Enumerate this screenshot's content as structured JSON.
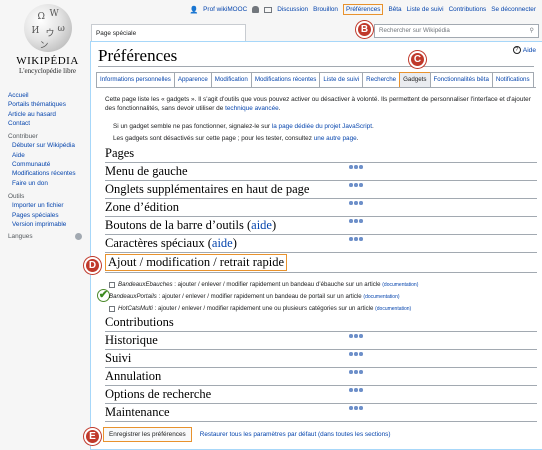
{
  "logo": {
    "wordmark": "WIKIPÉDIA",
    "tagline": "L'encyclopédie libre"
  },
  "personal": {
    "user": "Prof wikiMOOC",
    "links": [
      "Discussion",
      "Brouillon"
    ],
    "preferences": "Préférences",
    "more_links": [
      "Bêta",
      "Liste de suivi",
      "Contributions",
      "Se déconnecter"
    ]
  },
  "sidebar": {
    "nav": [
      "Accueil",
      "Portails thématiques",
      "Article au hasard",
      "Contact"
    ],
    "contribute_heading": "Contribuer",
    "contribute": [
      "Débuter sur Wikipédia",
      "Aide",
      "Communauté",
      "Modifications récentes",
      "Faire un don"
    ],
    "tools_heading": "Outils",
    "tools": [
      "Importer un fichier",
      "Pages spéciales",
      "Version imprimable"
    ],
    "languages_heading": "Langues"
  },
  "page_tab": "Page spéciale",
  "search": {
    "placeholder": "Rechercher sur Wikipédia"
  },
  "page": {
    "title": "Préférences",
    "help": "Aide",
    "tabs": [
      "Informations personnelles",
      "Apparence",
      "Modification",
      "Modifications récentes",
      "Liste de suivi",
      "Recherche",
      "Gadgets",
      "Fonctionnalités bêta",
      "Notifications"
    ],
    "intro_1": "Cette page liste les « gadgets ». Il s'agit d'outils que vous pouvez activer ou désactiver à volonté. Ils permettent de personnaliser l'interface et d'ajouter des fonctionnalités, sans devoir utiliser de ",
    "intro_link": "technique avancée",
    "intro_end": ".",
    "note_1": "Si un gadget semble ne pas fonctionner, signalez-le sur ",
    "note_1_link": "la page dédiée du projet JavaScript",
    "note_1_end": ".",
    "note_2": "Les gadgets sont désactivés sur cette page ; pour les tester, consultez ",
    "note_2_link": "une autre page",
    "note_2_end": ".",
    "sections": {
      "pages": "Pages",
      "menu": "Menu de gauche",
      "onglets": "Onglets supplémentaires en haut de page",
      "zone": "Zone d’édition",
      "boutons": "Boutons de la barre d’outils (",
      "boutons_link": "aide",
      "caracteres": "Caractères spéciaux (",
      "caracteres_link": "aide",
      "close_paren": ")",
      "ajout": "Ajout / modification / retrait rapide",
      "contributions": "Contributions",
      "historique": "Historique",
      "suivi": "Suivi",
      "annulation": "Annulation",
      "options": "Options de recherche",
      "maintenance": "Maintenance"
    },
    "gadgets": [
      {
        "name": "BandeauxEbauches",
        "desc": " : ajouter / enlever / modifier rapidement un bandeau d’ébauche sur un article ",
        "doc": "(documentation)"
      },
      {
        "name": "BandeauxPortails",
        "desc": " : ajouter / enlever / modifier rapidement un bandeau de portail sur un article ",
        "doc": "(documentation)"
      },
      {
        "name": "HotCatsMulti",
        "desc": " : ajouter / enlever / modifier rapidement une ou plusieurs catégories sur un article ",
        "doc": "(documentation)"
      }
    ],
    "save_button": "Enregistrer les préférences",
    "restore_link": "Restaurer tous les paramètres par défaut (dans toutes les sections)"
  },
  "callouts": {
    "b": "B",
    "c": "C",
    "d": "D",
    "e": "E"
  },
  "colors": {
    "highlight": "#e8922d",
    "callout": "#c0392b",
    "link": "#0645ad"
  }
}
